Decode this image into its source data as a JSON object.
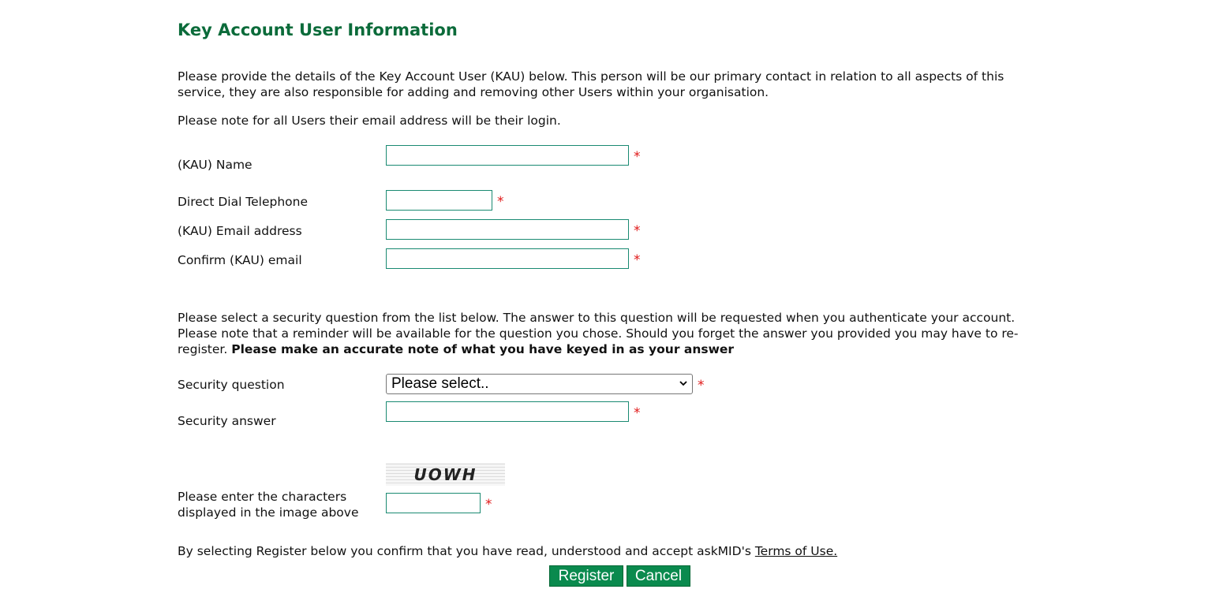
{
  "page": {
    "title": "Key Account User Information",
    "intro_paragraph": "Please provide the details of the Key Account User (KAU) below. This person will be our primary contact in relation to all aspects of this service, they are also responsible for adding and removing other Users within your organisation.",
    "login_note": "Please note for all Users their email address will be their login."
  },
  "form": {
    "required_marker": "*",
    "fields": {
      "name": {
        "label": "(KAU) Name",
        "value": ""
      },
      "telephone": {
        "label": "Direct Dial Telephone",
        "value": ""
      },
      "email": {
        "label": "(KAU) Email address",
        "value": ""
      },
      "confirm_email": {
        "label": "Confirm (KAU) email",
        "value": ""
      }
    },
    "security_paragraph": "Please select a security question from the list below. The answer to this question will be requested when you authenticate your account. Please note that a reminder will be available for the question you chose. Should you forget the answer you provided you may have to re-register. ",
    "security_paragraph_bold": "Please make an accurate note of what you have keyed in as your answer",
    "security_question": {
      "label": "Security question",
      "selected": "Please select.."
    },
    "security_answer": {
      "label": "Security answer",
      "value": ""
    },
    "captcha": {
      "text": "UOWH",
      "label_line1": "Please enter the characters",
      "label_line2": "displayed in the image above",
      "value": ""
    },
    "terms_text": "By selecting Register below you confirm that you have read, understood and accept askMID's ",
    "terms_link": "Terms of Use.",
    "buttons": {
      "register": "Register",
      "cancel": "Cancel"
    }
  }
}
